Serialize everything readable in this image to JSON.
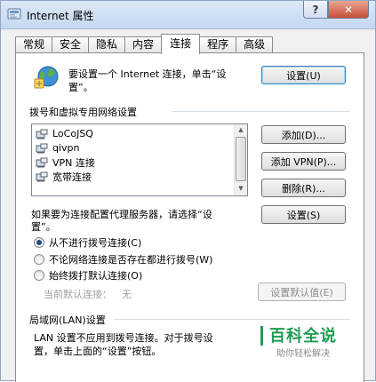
{
  "window": {
    "title": "Internet 属性",
    "help_label": "?",
    "close_label": "✕"
  },
  "tabs": [
    "常规",
    "安全",
    "隐私",
    "内容",
    "连接",
    "程序",
    "高级"
  ],
  "active_tab": "连接",
  "setup": {
    "line1": "要设置一个 Internet 连接，单击“设",
    "line2": "置”。",
    "button": "设置(U)"
  },
  "dialup": {
    "group_label": "拨号和虚拟专用网络设置",
    "connections": [
      "LoCoJSQ",
      "qivpn",
      "VPN 连接",
      "宽带连接"
    ],
    "add_button": "添加(D)...",
    "add_vpn_button": "添加 VPN(P)...",
    "delete_button": "删除(R)...",
    "proxy_line1": "如果要为连接配置代理服务器，请选择“设",
    "proxy_line2": "置”。",
    "settings_button": "设置(S)",
    "options": [
      {
        "label": "从不进行拨号连接(C)",
        "checked": true
      },
      {
        "label": "不论网络连接是否存在都进行拨号(W)",
        "checked": false
      },
      {
        "label": "始终拨打默认连接(O)",
        "checked": false
      }
    ],
    "current_default_label": "当前默认连接：",
    "current_default_value": "无",
    "set_default_button": "设置默认值(E)"
  },
  "lan": {
    "group_label": "局域网(LAN)设置",
    "line1": "LAN 设置不应用到拨号连接。对于拨号设",
    "line2": "置，单击上面的“设置”按钮。"
  },
  "watermark": {
    "title": "百科全说",
    "subtitle": "助你轻松解决"
  },
  "colors": {
    "watermark_green": "#1e9b52",
    "default_button_border": "#3c7fb1"
  }
}
